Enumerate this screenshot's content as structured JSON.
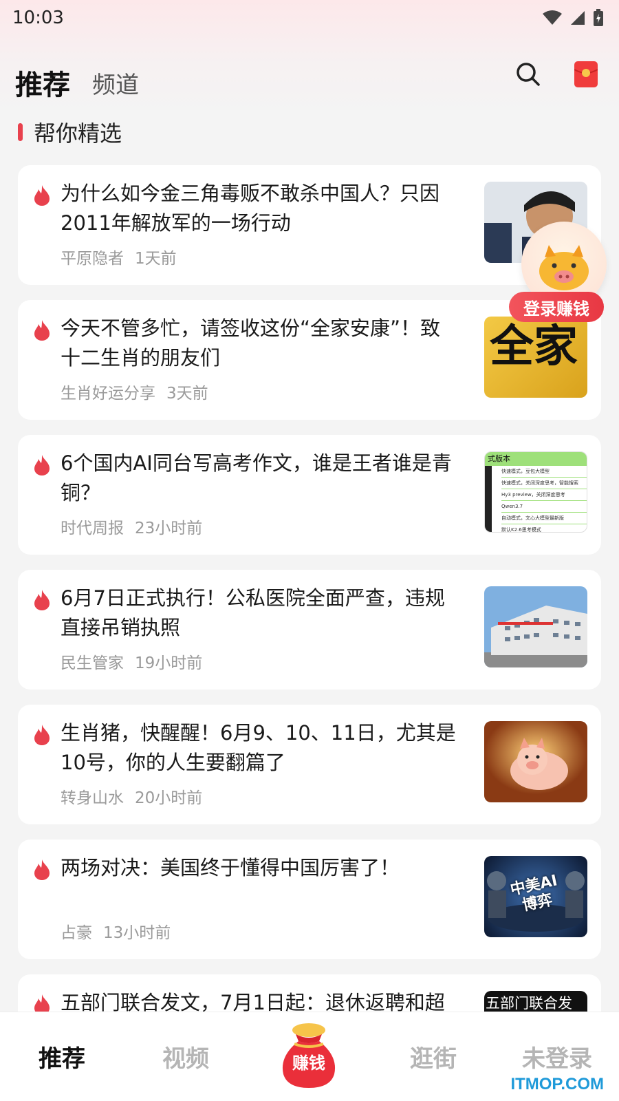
{
  "status_bar": {
    "time": "10:03"
  },
  "header": {
    "tab_recommend": "推荐",
    "tab_channel": "频道"
  },
  "section": {
    "title": "帮你精选"
  },
  "feed": [
    {
      "title": "为什么如今金三角毒贩不敢杀中国人？只因2011年解放军的一场行动",
      "author": "平原隐者",
      "time": "1天前"
    },
    {
      "title": "今天不管多忙，请签收这份“全家安康”！致十二生肖的朋友们",
      "author": "生肖好运分享",
      "time": "3天前",
      "thumb_text_1": "全",
      "thumb_text_2": "家"
    },
    {
      "title": "6个国内AI同台写高考作文，谁是王者谁是青铜？",
      "author": "时代周报",
      "time": "23小时前",
      "thumb_header": "式版本",
      "thumb_rows": [
        "快速模式，豆包大模型",
        "快速模式，关闭深度思考，智能搜索",
        "Hy3 preview，关闭深度思考",
        "Qwen3.7",
        "自动模式，文心大模型最新版",
        "默认K2.6思考模式"
      ]
    },
    {
      "title": "6月7日正式执行！公私医院全面严查，违规直接吊销执照",
      "author": "民生管家",
      "time": "19小时前"
    },
    {
      "title": "生肖猪，快醒醒！6月9、10、11日，尤其是10号，你的人生要翻篇了",
      "author": "转身山水",
      "time": "20小时前"
    },
    {
      "title": "两场对决：美国终于懂得中国厉害了！",
      "author": "占豪",
      "time": "13小时前",
      "thumb_text": "中美AI博弈"
    },
    {
      "title": "五部门联合发文，7月1日起：退休返聘和超",
      "author": "",
      "time": "",
      "thumb_text": "五部门联合发"
    }
  ],
  "promo": {
    "label": "登录赚钱"
  },
  "bottom_nav": {
    "recommend": "推荐",
    "video": "视频",
    "earn": "赚钱",
    "shop": "逛街",
    "account": "未登录"
  },
  "watermark": "ITMOP.COM",
  "colors": {
    "accent": "#e8414d",
    "title": "#1a1a1a",
    "meta": "#9a9a9a"
  }
}
